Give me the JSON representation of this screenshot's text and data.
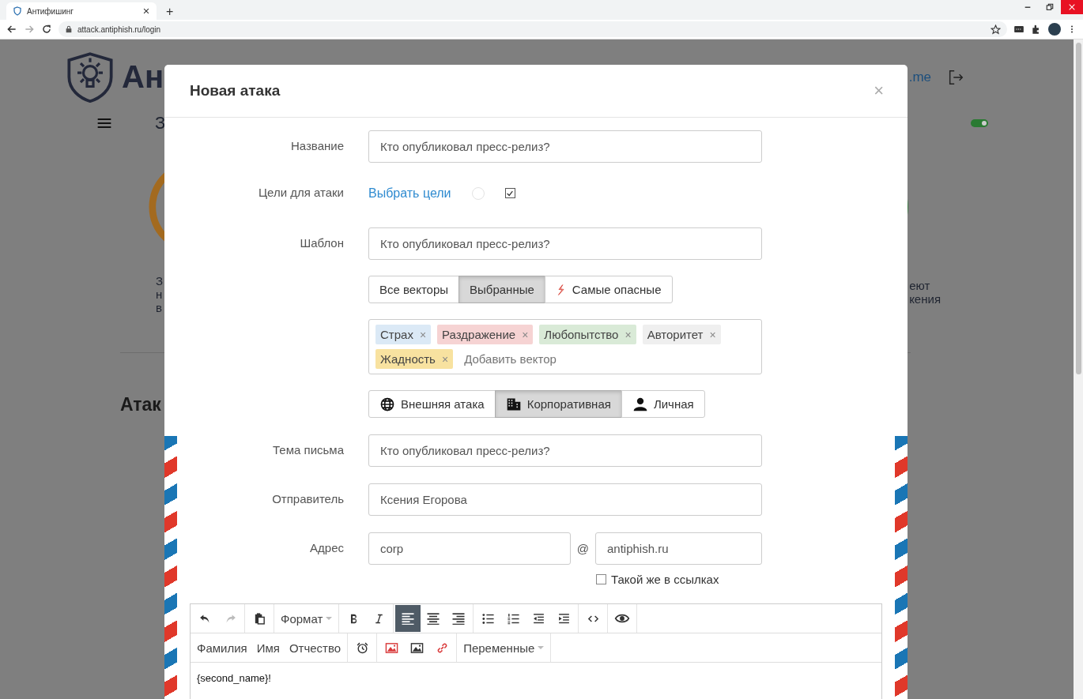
{
  "browser": {
    "tab_title": "Антифишинг",
    "new_tab": "+",
    "url": "attack.antiphish.ru/login"
  },
  "background": {
    "logo_text": "Ан",
    "nav_fragment": "З",
    "account_link": ".me",
    "toggle_on": true,
    "left_text": [
      "З",
      "н",
      "в"
    ],
    "right_text": [
      "еют",
      "кения"
    ],
    "section_title": "Атак"
  },
  "modal": {
    "title": "Новая атака",
    "close": "×",
    "name": {
      "label": "Название",
      "value": "Кто опубликовал пресс-релиз?"
    },
    "targets": {
      "label": "Цели для атаки",
      "link": "Выбрать цели",
      "radio_selected": false,
      "checkbox_checked": true
    },
    "template": {
      "label": "Шаблон",
      "value": "Кто опубликовал пресс-релиз?",
      "filters": [
        {
          "label": "Все векторы",
          "selected": false,
          "kind": "plain"
        },
        {
          "label": "Выбранные",
          "selected": true,
          "kind": "plain"
        },
        {
          "label": "Самые опасные",
          "selected": false,
          "kind": "danger"
        }
      ],
      "vectors": [
        {
          "label": "Страх",
          "color": "#dbe9f6",
          "remove": "×"
        },
        {
          "label": "Раздражение",
          "color": "#f6d3d3",
          "remove": "×"
        },
        {
          "label": "Любопытство",
          "color": "#d9ead7",
          "remove": "×"
        },
        {
          "label": "Авторитет",
          "color": "#efefef",
          "remove": "×"
        },
        {
          "label": "Жадность",
          "color": "#f8e2a0",
          "remove": "×"
        }
      ],
      "vector_placeholder": "Добавить вектор",
      "attack_types": [
        {
          "label": "Внешняя атака",
          "selected": false,
          "kind": "external"
        },
        {
          "label": "Корпоративная",
          "selected": true,
          "kind": "corporate"
        },
        {
          "label": "Личная",
          "selected": false,
          "kind": "personal"
        }
      ]
    },
    "subject": {
      "label": "Тема письма",
      "value": "Кто опубликовал пресс-релиз?"
    },
    "sender": {
      "label": "Отправитель",
      "value": "Ксения Егорова"
    },
    "address": {
      "label": "Адрес",
      "local": "corp",
      "at": "@",
      "domain": "antiphish.ru",
      "same_in_links": {
        "label": "Такой же в ссылках",
        "checked": false
      }
    },
    "editor": {
      "rows": [
        [
          {
            "items": [
              {
                "kind": "undo",
                "disabled": false
              },
              {
                "kind": "redo",
                "disabled": true
              }
            ]
          },
          {
            "items": [
              {
                "kind": "paste"
              }
            ]
          },
          {
            "items": [
              {
                "kind": "dropdown",
                "label": "Формат"
              }
            ]
          },
          {
            "items": [
              {
                "kind": "bold"
              },
              {
                "kind": "italic"
              }
            ]
          },
          {
            "items": [
              {
                "kind": "align-left",
                "selected": true
              },
              {
                "kind": "align-center",
                "selected": false
              },
              {
                "kind": "align-right",
                "selected": false
              }
            ]
          },
          {
            "items": [
              {
                "kind": "bullets"
              },
              {
                "kind": "numbers"
              },
              {
                "kind": "outdent"
              },
              {
                "kind": "indent"
              }
            ]
          },
          {
            "items": [
              {
                "kind": "code"
              }
            ]
          },
          {
            "items": [
              {
                "kind": "preview"
              }
            ]
          }
        ],
        [
          {
            "items": [
              {
                "kind": "text",
                "label": "Фамилия"
              },
              {
                "kind": "text",
                "label": "Имя"
              },
              {
                "kind": "text",
                "label": "Отчество"
              }
            ]
          },
          {
            "items": [
              {
                "kind": "alarm"
              }
            ]
          },
          {
            "items": [
              {
                "kind": "phish-image"
              },
              {
                "kind": "image"
              },
              {
                "kind": "phish-link"
              }
            ]
          },
          {
            "items": [
              {
                "kind": "dropdown",
                "label": "Переменные"
              }
            ]
          }
        ]
      ],
      "content": "{second_name}!"
    }
  }
}
